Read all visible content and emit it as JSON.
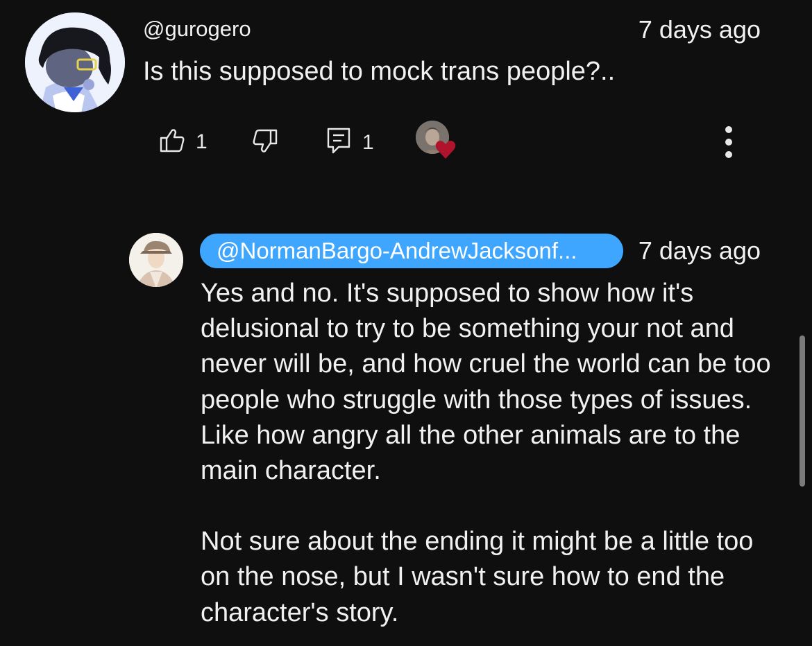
{
  "comment": {
    "author": "@gurogero",
    "time": "7 days ago",
    "text": "Is this supposed to mock trans people?..",
    "like_count": "1",
    "reply_count": "1",
    "icons": {
      "like": "thumbs-up-icon",
      "dislike": "thumbs-down-icon",
      "reply": "reply-icon",
      "hearted": "creator-heart-icon",
      "more": "more-vert-icon"
    },
    "colors": {
      "heart": "#c1122f"
    }
  },
  "reply": {
    "author": "@NormanBargo-AndrewJacksonf...",
    "time": "7 days ago",
    "paragraphs": [
      "Yes and no. It's supposed to show how it's delusional to try to be something your not and never will be, and how cruel the world can be too people who struggle with those types of issues. Like how angry all the other animals are to the main character.",
      "Not sure about the ending it might be a little too on the nose, but I wasn't sure how to end the character's story."
    ],
    "colors": {
      "author_pill": "#3ea6ff"
    }
  },
  "theme": {
    "background": "#0f0f0f",
    "text": "#f1f1f1"
  }
}
